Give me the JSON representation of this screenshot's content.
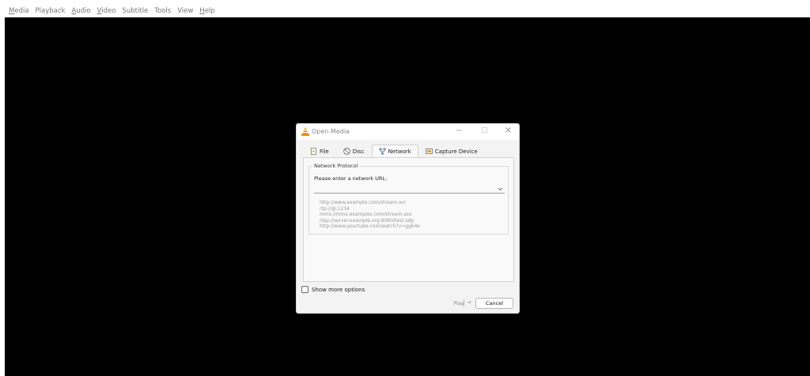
{
  "menubar": {
    "items": [
      {
        "label": "Media",
        "underline": "M",
        "rest": "edia",
        "highlighted": true
      },
      {
        "label": "Playback",
        "underline": "",
        "rest": "Playback"
      },
      {
        "label": "Audio",
        "underline": "A",
        "rest": "udio"
      },
      {
        "label": "Video",
        "underline": "V",
        "rest": "ideo"
      },
      {
        "label": "Subtitle",
        "underline": "",
        "rest": "Subtitle"
      },
      {
        "label": "Tools",
        "underline": "",
        "rest": "Tools"
      },
      {
        "label": "View",
        "underline": "",
        "rest": "View"
      },
      {
        "label": "Help",
        "underline": "H",
        "rest": "elp"
      }
    ]
  },
  "dialog": {
    "title": "Open Media",
    "tabs": [
      {
        "label": "File",
        "icon": "file-icon"
      },
      {
        "label": "Disc",
        "icon": "disc-icon"
      },
      {
        "label": "Network",
        "icon": "network-icon",
        "active": true
      },
      {
        "label": "Capture Device",
        "icon": "capture-device-icon"
      }
    ],
    "group_title": "Network Protocol",
    "url_label": "Please enter a network URL:",
    "url_value": "",
    "examples": [
      "http://www.example.com/stream.avi",
      "rtp://@:1234",
      "mms://mms.examples.com/stream.asx",
      "rtsp://server.example.org:8080/test.sdp",
      "http://www.yourtube.com/watch?v=gg64x"
    ],
    "show_more_label": "Show more options",
    "play_label": "Play",
    "cancel_label": "Cancel"
  },
  "colors": {
    "highlight": "#fff500",
    "video_bg": "#000000",
    "vlc_orange": "#f08a00"
  }
}
